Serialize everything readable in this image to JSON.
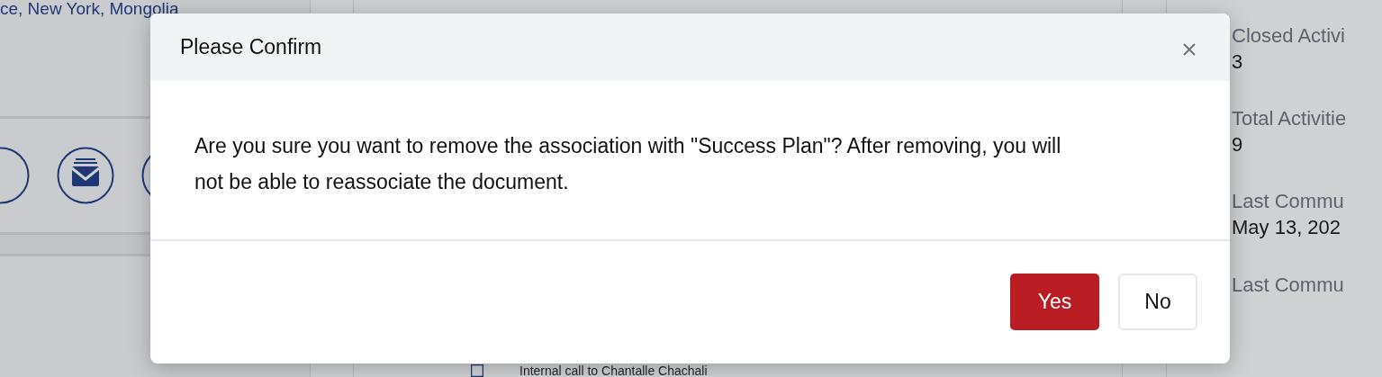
{
  "background": {
    "location_text": "ce, New York, Mongolia",
    "activity_row": "Internal call to Chantalle Chachali",
    "stats": [
      {
        "label": "Closed Activi",
        "value": "3"
      },
      {
        "label": "Total Activitie",
        "value": "9"
      },
      {
        "label": "Last Commu",
        "value": "May 13, 202"
      },
      {
        "label": "Last Commu"
      }
    ]
  },
  "dialog": {
    "title": "Please Confirm",
    "message": "Are you sure you want to remove the association with \"Success Plan\"? After removing, you will not be able to reassociate the document.",
    "buttons": [
      {
        "label": "Yes",
        "kind": "primary"
      },
      {
        "label": "No",
        "kind": "secondary"
      }
    ]
  }
}
